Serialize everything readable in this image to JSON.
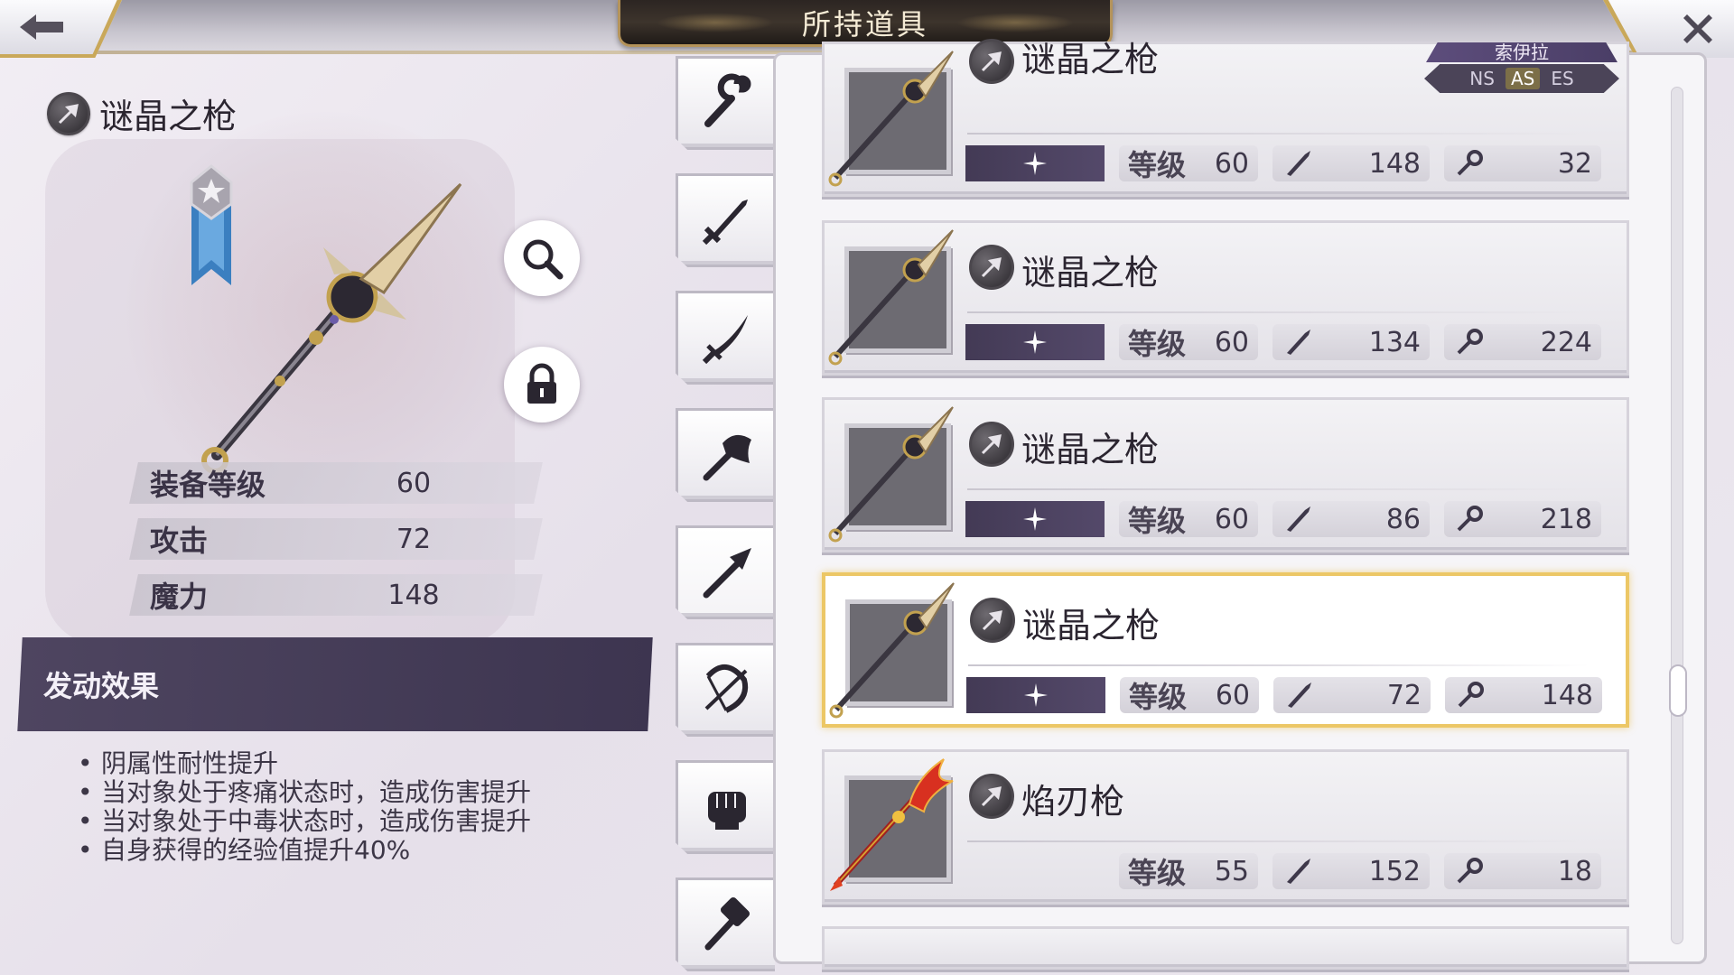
{
  "header": {
    "title": "所持道具",
    "back_icon": "back-arrow-icon",
    "close_icon": "close-icon"
  },
  "detail": {
    "name": "谜晶之枪",
    "type_icon": "spear-type-icon",
    "stats": [
      {
        "label": "装备等级",
        "value": "60"
      },
      {
        "label": "攻击",
        "value": "72"
      },
      {
        "label": "魔力",
        "value": "148"
      }
    ],
    "effect_title": "发动效果",
    "effects": [
      "阴属性耐性提升",
      "当对象处于疼痛状态时，造成伤害提升",
      "当对象处于中毒状态时，造成伤害提升",
      "自身获得的经验值提升40%"
    ]
  },
  "categories": [
    {
      "icon": "staff-icon"
    },
    {
      "icon": "sword-icon"
    },
    {
      "icon": "katana-icon"
    },
    {
      "icon": "axe-icon"
    },
    {
      "icon": "spear-icon",
      "active": true
    },
    {
      "icon": "bow-icon"
    },
    {
      "icon": "fist-icon"
    },
    {
      "icon": "hammer-icon"
    }
  ],
  "list": {
    "level_label": "等级",
    "items": [
      {
        "name": "谜晶之枪",
        "level": "60",
        "atk": "148",
        "mag": "32",
        "character": "索伊拉",
        "variants": [
          "NS",
          "AS",
          "ES"
        ],
        "active_variant": "AS"
      },
      {
        "name": "谜晶之枪",
        "level": "60",
        "atk": "134",
        "mag": "224"
      },
      {
        "name": "谜晶之枪",
        "level": "60",
        "atk": "86",
        "mag": "218"
      },
      {
        "name": "谜晶之枪",
        "level": "60",
        "atk": "72",
        "mag": "148",
        "selected": true
      },
      {
        "name": "焰刃枪",
        "level": "55",
        "atk": "152",
        "mag": "18"
      }
    ]
  },
  "colors": {
    "selected_border": "#ecc766",
    "title_plate": "#2c2522",
    "effect_band": "#4e4560"
  }
}
